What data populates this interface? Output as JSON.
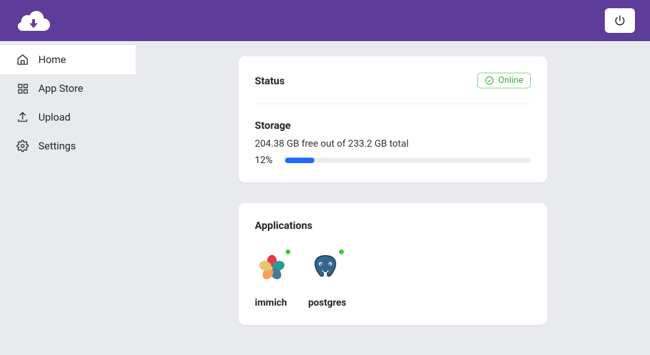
{
  "sidebar": {
    "items": [
      {
        "label": "Home",
        "icon": "home-icon"
      },
      {
        "label": "App Store",
        "icon": "grid-icon"
      },
      {
        "label": "Upload",
        "icon": "upload-icon"
      },
      {
        "label": "Settings",
        "icon": "gear-icon"
      }
    ]
  },
  "status": {
    "title": "Status",
    "badge": "Online"
  },
  "storage": {
    "title": "Storage",
    "summary": "204.38 GB free out of 233.2 GB total",
    "percent_label": "12%",
    "percent": 12
  },
  "applications": {
    "title": "Applications",
    "items": [
      {
        "name": "immich"
      },
      {
        "name": "postgres"
      }
    ]
  }
}
